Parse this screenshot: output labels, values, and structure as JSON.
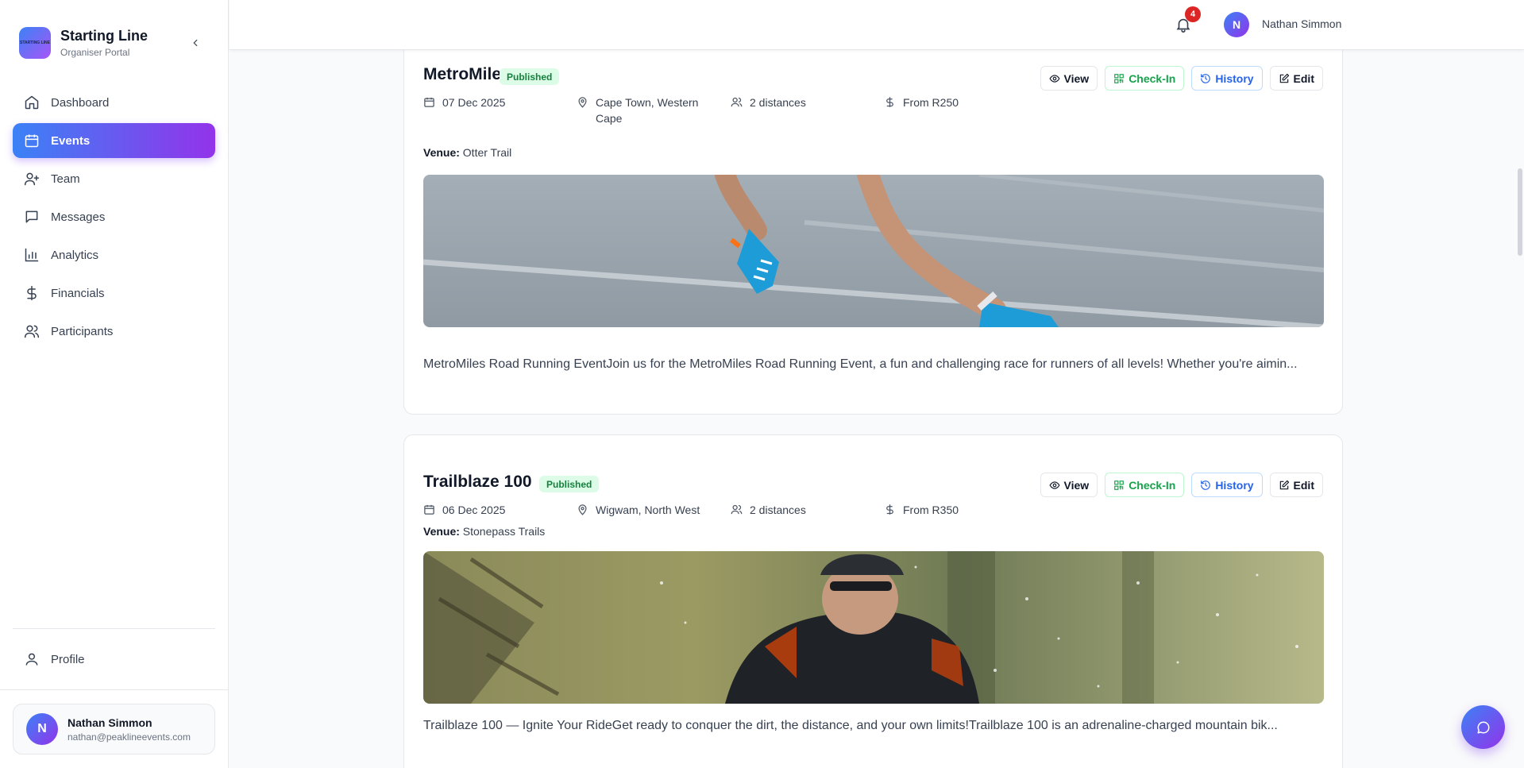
{
  "brand": {
    "logo_text": "STARTING LINE",
    "title": "Starting Line",
    "subtitle": "Organiser Portal"
  },
  "sidebar": {
    "items": [
      {
        "label": "Dashboard",
        "icon": "home-icon"
      },
      {
        "label": "Events",
        "icon": "calendar-icon",
        "active": true
      },
      {
        "label": "Team",
        "icon": "user-plus-icon"
      },
      {
        "label": "Messages",
        "icon": "message-icon"
      },
      {
        "label": "Analytics",
        "icon": "bar-chart-icon"
      },
      {
        "label": "Financials",
        "icon": "dollar-icon"
      },
      {
        "label": "Participants",
        "icon": "users-icon"
      }
    ],
    "profile_label": "Profile"
  },
  "user": {
    "initial": "N",
    "name": "Nathan Simmon",
    "email": "nathan@peaklineevents.com"
  },
  "header": {
    "notification_count": "4",
    "user_initial": "N",
    "user_name": "Nathan Simmon"
  },
  "actions": {
    "view": "View",
    "checkin": "Check-In",
    "history": "History",
    "edit": "Edit"
  },
  "events": [
    {
      "title": "MetroMiles",
      "status": "Published",
      "date": "07 Dec 2025",
      "location": "Cape Town, Western Cape",
      "distances": "2 distances",
      "price": "From R250",
      "venue_label": "Venue:",
      "venue": "Otter Trail",
      "description": "MetroMiles Road Running EventJoin us for the MetroMiles Road Running Event, a fun and challenging race for runners of all levels! Whether you're aimin..."
    },
    {
      "title": "Trailblaze 100",
      "status": "Published",
      "date": "06 Dec 2025",
      "location": "Wigwam, North West",
      "distances": "2 distances",
      "price": "From R350",
      "venue_label": "Venue:",
      "venue": "Stonepass Trails",
      "description": "Trailblaze 100 — Ignite Your RideGet ready to conquer the dirt, the distance, and your own limits!Trailblaze 100 is an adrenaline-charged mountain bik..."
    }
  ],
  "colors": {
    "accent_start": "#3b82f6",
    "accent_end": "#9333ea",
    "published_bg": "#dcfce7",
    "published_text": "#15803d",
    "checkin": "#16a34a",
    "history": "#2563eb",
    "badge": "#dc2626"
  }
}
